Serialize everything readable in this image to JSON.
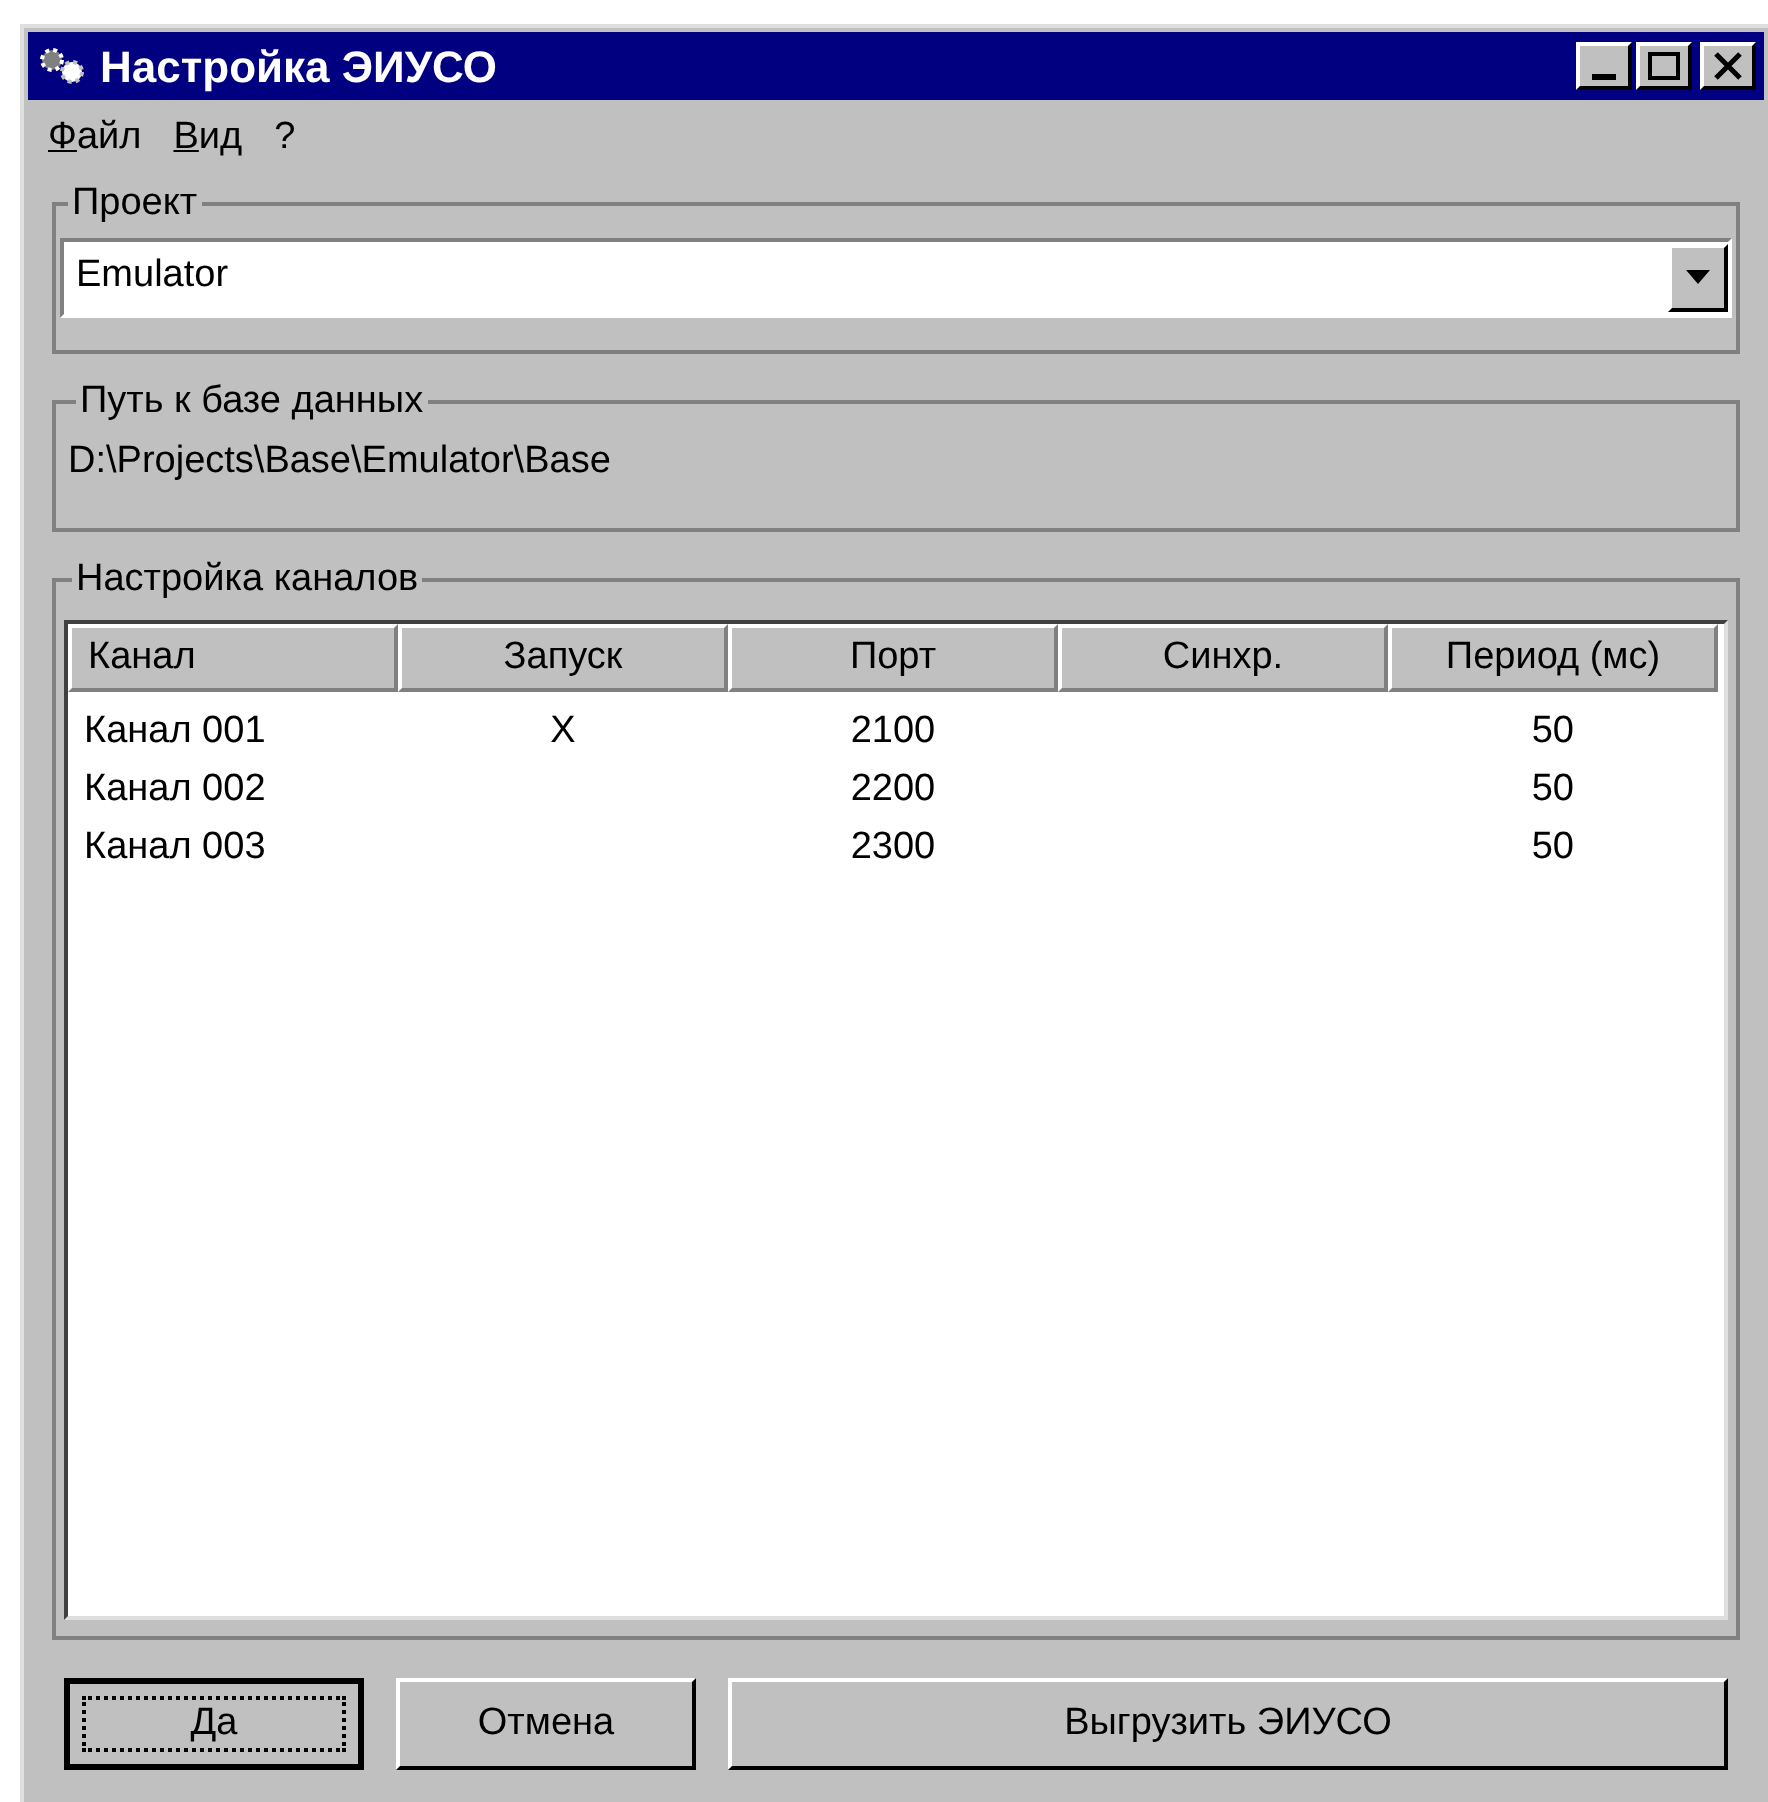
{
  "window": {
    "title": "Настройка ЭИУСО"
  },
  "menu": [
    {
      "label": "Файл",
      "mnemonic": true
    },
    {
      "label": "Вид",
      "mnemonic": true
    },
    {
      "label": "?",
      "mnemonic": false
    }
  ],
  "project": {
    "legend": "Проект",
    "value": "Emulator"
  },
  "db_path": {
    "legend": "Путь к базе данных",
    "value": "D:\\Projects\\Base\\Emulator\\Base"
  },
  "channels": {
    "legend": "Настройка каналов",
    "columns": [
      "Канал",
      "Запуск",
      "Порт",
      "Синхр.",
      "Период (мс)"
    ],
    "rows": [
      [
        "Канал 001",
        "X",
        "2100",
        "",
        "50"
      ],
      [
        "Канал 002",
        "",
        "2200",
        "",
        "50"
      ],
      [
        "Канал 003",
        "",
        "2300",
        "",
        "50"
      ]
    ]
  },
  "buttons": [
    {
      "label": "Да",
      "default": true
    },
    {
      "label": "Отмена",
      "default": false
    },
    {
      "label": "Выгрузить ЭИУСО",
      "default": false
    }
  ]
}
